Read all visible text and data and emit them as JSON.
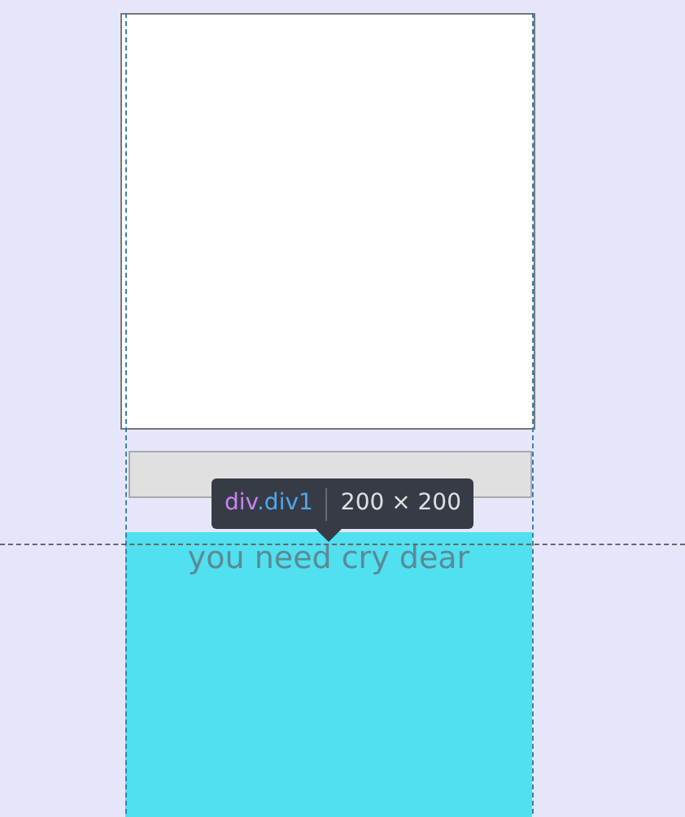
{
  "tooltip": {
    "tag": "div",
    "class_name": ".div1",
    "size": "200 × 200"
  },
  "cyan_box": {
    "text": "you need cry dear"
  }
}
